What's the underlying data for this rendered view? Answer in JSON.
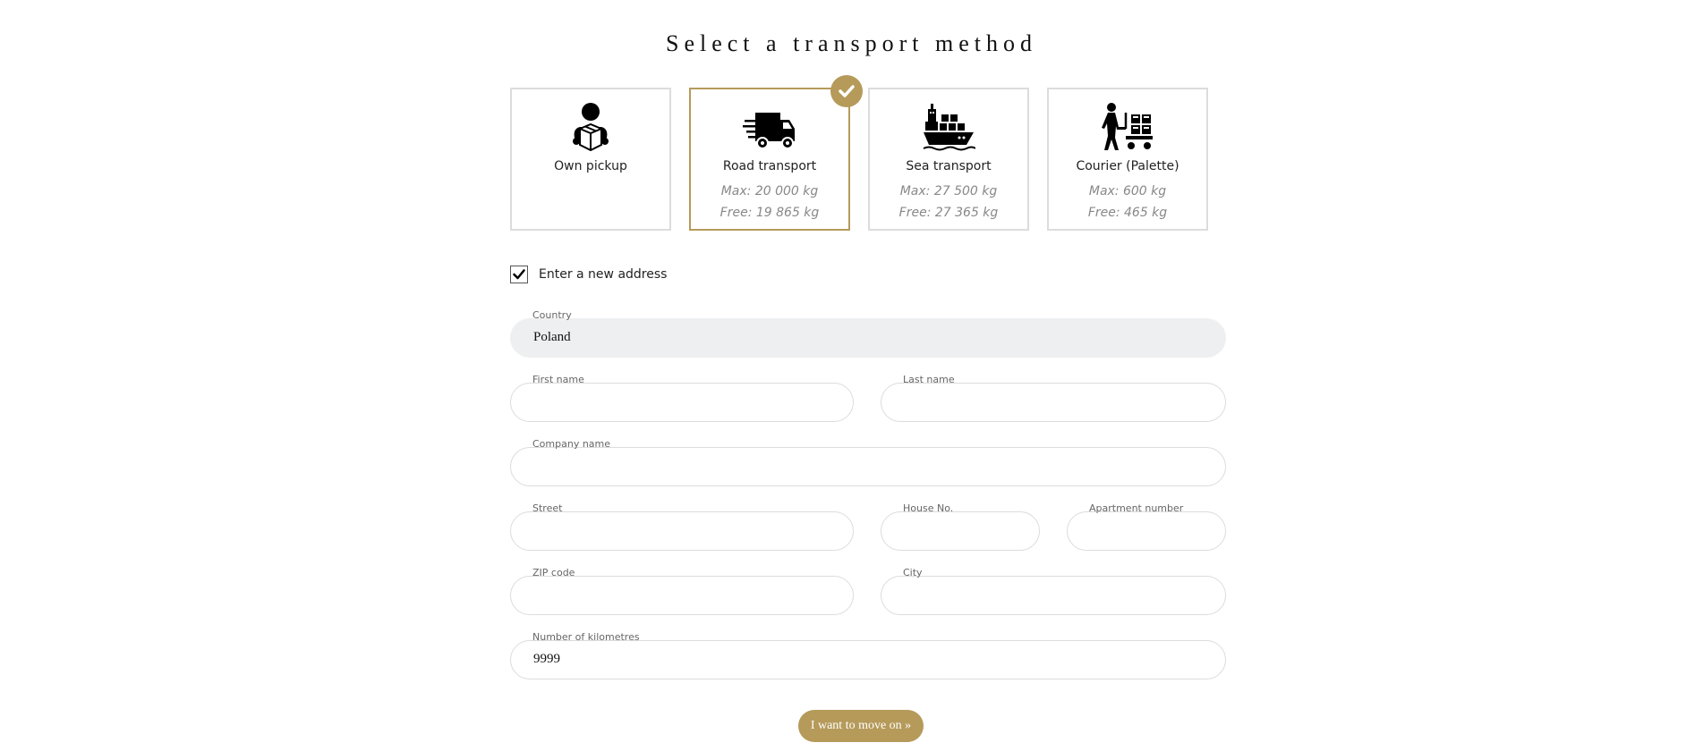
{
  "title": "Select a transport method",
  "methods": [
    {
      "name": "Own pickup",
      "icon": "person-with-box-icon",
      "max": "",
      "free": "",
      "selected": false
    },
    {
      "name": "Road transport",
      "icon": "delivery-truck-icon",
      "max": "Max: 20 000 kg",
      "free": "Free: 19 865 kg",
      "selected": true
    },
    {
      "name": "Sea transport",
      "icon": "cargo-ship-icon",
      "max": "Max: 27 500 kg",
      "free": "Free: 27 365 kg",
      "selected": false
    },
    {
      "name": "Courier (Palette)",
      "icon": "courier-cart-icon",
      "max": "Max: 600 kg",
      "free": "Free: 465 kg",
      "selected": false
    }
  ],
  "new_address": {
    "label": "Enter a new address",
    "checked": true
  },
  "form": {
    "country": {
      "label": "Country",
      "value": "Poland"
    },
    "first_name": {
      "label": "First name",
      "value": ""
    },
    "last_name": {
      "label": "Last name",
      "value": ""
    },
    "company_name": {
      "label": "Company name",
      "value": ""
    },
    "street": {
      "label": "Street",
      "value": ""
    },
    "house_no": {
      "label": "House No.",
      "value": ""
    },
    "apartment_number": {
      "label": "Apartment number",
      "value": ""
    },
    "zip_code": {
      "label": "ZIP code",
      "value": ""
    },
    "city": {
      "label": "City",
      "value": ""
    },
    "kilometres": {
      "label": "Number of kilometres",
      "value": "9999"
    }
  },
  "submit_label": "I want to move on »",
  "colors": {
    "accent": "#b59a5a",
    "border": "#dcdcdc",
    "gray_field": "#eeeff0"
  }
}
